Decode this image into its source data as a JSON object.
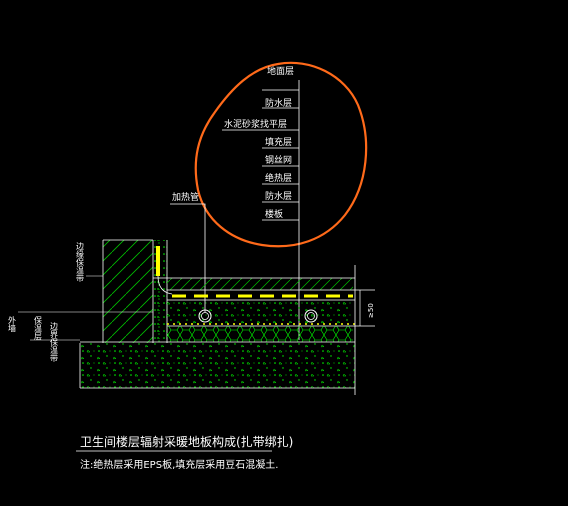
{
  "layers": [
    "地面层",
    "防水层",
    "水泥砂浆找平层",
    "填充层",
    "钢丝网",
    "绝热层",
    "防水层",
    "楼板"
  ],
  "labels": {
    "heating_pipe": "加热管",
    "wall_insulation": "边缘保温带",
    "outer_wall": "外墙",
    "insulation": "保温层",
    "edge_strip": "边界保温带"
  },
  "dimension": "≥50",
  "title": "卫生间楼层辐射采暖地板构成(扎带绑扎)",
  "note": "注:绝热层采用EPS板,填充层采用豆石混凝土.",
  "colors": {
    "line": "#ffffff",
    "hatch": "#00ff00",
    "accent": "#ffff00",
    "annotation": "#ff6a1a"
  }
}
